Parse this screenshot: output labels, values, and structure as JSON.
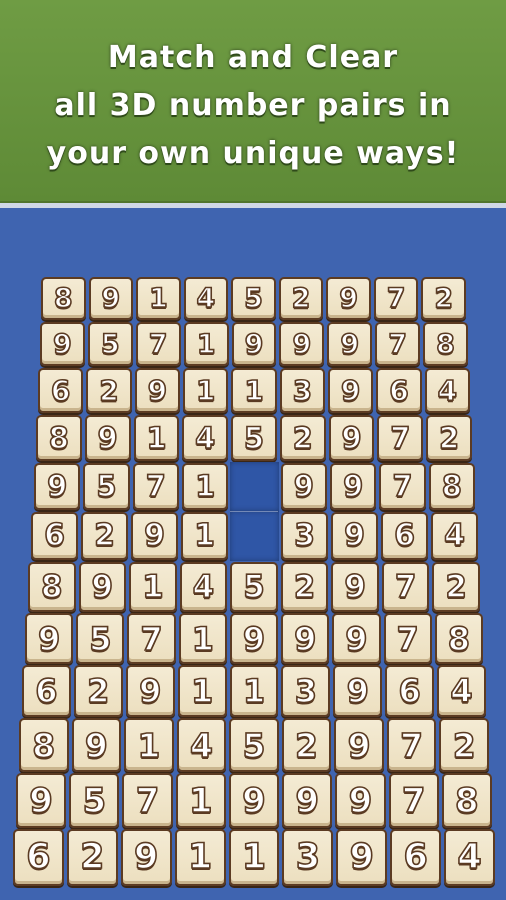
{
  "banner": {
    "line1": "Match and Clear",
    "line2": "all 3D number pairs in",
    "line3": "your own unique ways!"
  },
  "colors": {
    "banner_green": "#6f9c44",
    "board_blue": "#3f64b0",
    "tile_face": "#f4ebd4",
    "tile_border": "#5c3b22"
  },
  "board": {
    "rows": [
      [
        "8",
        "9",
        "1",
        "4",
        "5",
        "2",
        "9",
        "7",
        "2"
      ],
      [
        "9",
        "5",
        "7",
        "1",
        "9",
        "9",
        "9",
        "7",
        "8"
      ],
      [
        "6",
        "2",
        "9",
        "1",
        "1",
        "3",
        "9",
        "6",
        "4"
      ],
      [
        "8",
        "9",
        "1",
        "4",
        "5",
        "2",
        "9",
        "7",
        "2"
      ],
      [
        "9",
        "5",
        "7",
        "1",
        "",
        "9",
        "9",
        "7",
        "8"
      ],
      [
        "6",
        "2",
        "9",
        "1",
        "",
        "3",
        "9",
        "6",
        "4"
      ],
      [
        "8",
        "9",
        "1",
        "4",
        "5",
        "2",
        "9",
        "7",
        "2"
      ],
      [
        "9",
        "5",
        "7",
        "1",
        "9",
        "9",
        "9",
        "7",
        "8"
      ],
      [
        "6",
        "2",
        "9",
        "1",
        "1",
        "3",
        "9",
        "6",
        "4"
      ],
      [
        "8",
        "9",
        "1",
        "4",
        "5",
        "2",
        "9",
        "7",
        "2"
      ],
      [
        "9",
        "5",
        "7",
        "1",
        "9",
        "9",
        "9",
        "7",
        "8"
      ],
      [
        "6",
        "2",
        "9",
        "1",
        "1",
        "3",
        "9",
        "6",
        "4"
      ]
    ]
  }
}
